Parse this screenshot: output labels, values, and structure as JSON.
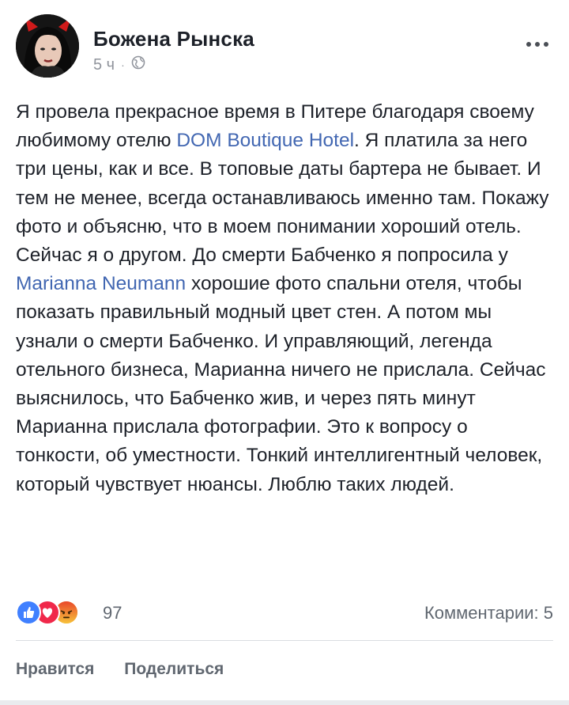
{
  "author": {
    "name": "Божена Рынска",
    "time": "5 ч"
  },
  "icons": {
    "globe": "globe-icon",
    "more": "more-icon"
  },
  "post": {
    "segments": [
      {
        "text": "Я провела прекрасное время в Питере благодаря своему любимому отелю ",
        "type": "text"
      },
      {
        "text": "DOM Boutique Hotel",
        "type": "link"
      },
      {
        "text": ". Я платила за него три цены, как и все. В топовые даты бартера не бывает. И тем не менее, всегда останавливаюсь именно там. Покажу фото и объясню, что в моем понимании хороший отель. Сейчас я о другом. До смерти Бабченко я попросила у ",
        "type": "text"
      },
      {
        "text": "Marianna Neumann",
        "type": "link"
      },
      {
        "text": " хорошие фото спальни отеля, чтобы показать правильный модный цвет стен. А потом мы узнали о смерти Бабченко. И управляющий, легенда отельного бизнеса, Марианна ничего не прислала. Сейчас выяснилось, что Бабченко жив, и через пять минут Марианна прислала фотографии. Это к вопросу о тонкости, об уместности. Тонкий интеллигентный человек, который чувствует нюансы. Люблю таких людей.",
        "type": "text"
      }
    ]
  },
  "reactions": {
    "count": "97",
    "comments": "Комментарии: 5"
  },
  "actions": {
    "like": "Нравится",
    "share": "Поделиться"
  },
  "colors": {
    "link": "#4267b2",
    "like": "#4080ff",
    "love": "#f0284a",
    "angry": "#f7b125"
  }
}
